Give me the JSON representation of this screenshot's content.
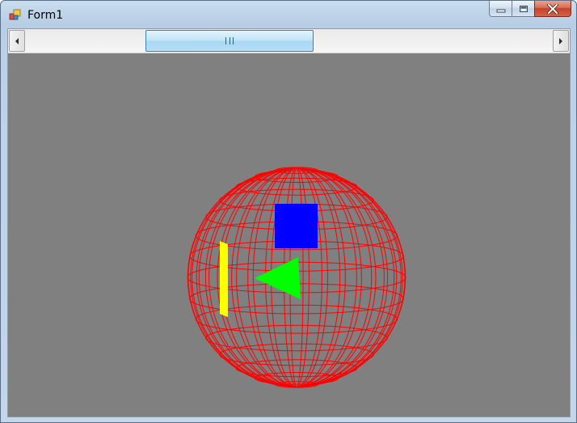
{
  "window": {
    "title": "Form1",
    "icon": "form-app-icon"
  },
  "caption_buttons": {
    "minimize": "minimize-icon",
    "maximize": "maximize-icon",
    "close": "close-icon"
  },
  "scrollbar": {
    "orientation": "horizontal",
    "left_arrow": "arrow-left-icon",
    "right_arrow": "arrow-right-icon",
    "thumb_grip": "grip-icon"
  },
  "scene": {
    "background": "#808080",
    "objects": [
      {
        "name": "wireframe-sphere",
        "color": "#ff0000"
      },
      {
        "name": "blue-square",
        "color": "#0000ff"
      },
      {
        "name": "green-triangle",
        "color": "#00ff00"
      },
      {
        "name": "yellow-bar",
        "color": "#ffff00"
      }
    ]
  },
  "colors": {
    "titlebar": "#c3d6ea",
    "close_button": "#c4422a",
    "scroll_thumb": "#b7def5"
  }
}
